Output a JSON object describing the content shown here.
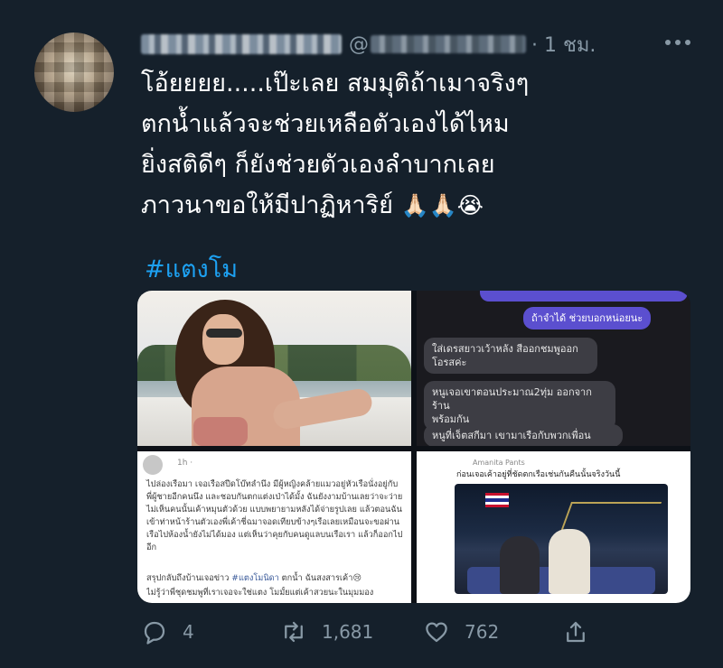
{
  "tweet": {
    "display_name": "",
    "handle_prefix": "@",
    "time": "· 1 ชม.",
    "lines": [
      "โอ้ยยยย.....เป๊ะเลย สมมุติถ้าเมาจริงๆ",
      "ตกน้ำแล้วจะช่วยเหลือตัวเองได้ไหม",
      "ยิ่งสติดีๆ ก็ยังช่วยตัวเองลำบากเลย",
      "ภาวนาขอให้มีปาฏิหาริย์"
    ],
    "emojis": "🙏🏻🙏🏻😭",
    "hashtag": "#แตงโม"
  },
  "media": {
    "chat": {
      "out_message": "ถ้าจำได้ ช่วยบอกหน่อยนะ",
      "in_messages": [
        "ใส่เดรสยาวเว้าหลัง สีออกชมพูออก\nโอรสค่ะ",
        "หนูเจอเขาตอนประมาณ2ทุ่ม ออกจากร้าน\nพร้อมกัน",
        "หนูที่เจ็ตสกีมา เขามาเรือกับพวกเพื่อน"
      ]
    },
    "doc": {
      "meta": "1h ·",
      "paragraph": "ไปล่องเรือมา เจอเรือสปีดโบ๊ทลำนึง มีผู้หญิงคล้ายแมวอยู่หัวเรือนั่งอยู่กับพี่ผู้ชายอีกคนนึง และชอบกันตกแต่งเป่าได้มั้ง ฉันยังงามบ้านเลยว่าจะว่ายไม่เห็นคนนั้นเค้าหมุนตัวด้วย แบบพยายามหลังได้จ่ายรูปเลย แล้วตอนฉันเข้าท่าหน้าร้านตัวเองพี่เค้าชี่ฉมาจอดเทียบข้างๆเรือเลยเหมือนจะขอผ่านเรือไปห้องน้ำยังไม่ได้มอง แต่เห็นว่าคุยกับคนดูแลบนเรือเรา แล้วก็ออกไปอีก",
      "summary_prefix": "สรุปกลับถึงบ้านเจอข่าว",
      "summary_tag": "#แตงโมนิดา",
      "summary_suffix": " ตกน้ำ ฉันสงสารเค้า😢",
      "summary_line2": "ไม่รู้ว่าพี่ชุดชมพูที่เราเจอจะใช่แตง โมมั้ยแต่เค้าสวยนะในมุมมอง"
    },
    "post": {
      "name": "Amanita Pants",
      "caption": "ก่อนเจอเค้าอยู่ที่ชัดตกเรือเช่นกันคืนนั้นจริงวันนี้"
    }
  },
  "actions": {
    "replies": "4",
    "retweets": "1,681",
    "likes": "762"
  },
  "colors": {
    "background": "#15202b",
    "text": "#ffffff",
    "muted": "#8899a6",
    "link": "#1da1f2",
    "chat_out": "#5b4fcf"
  }
}
